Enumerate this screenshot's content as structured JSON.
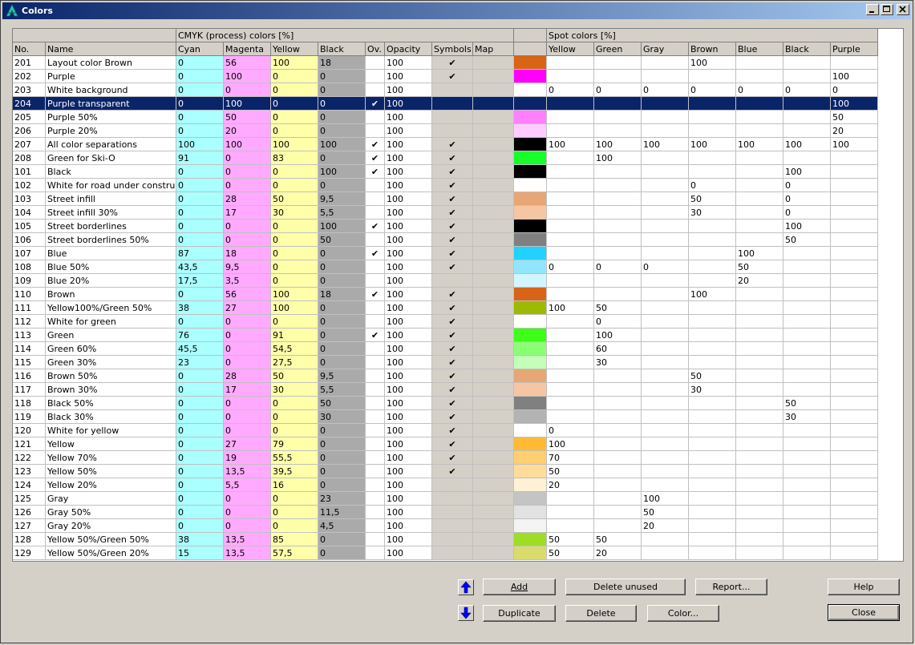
{
  "window": {
    "title": "Colors"
  },
  "header": {
    "group_cmyk": "CMYK (process) colors [%]",
    "group_spot": "Spot colors [%]",
    "columns": [
      "No.",
      "Name",
      "Cyan",
      "Magenta",
      "Yellow",
      "Black",
      "Ov.",
      "Opacity",
      "Symbols",
      "Map",
      "",
      "Yellow",
      "Green",
      "Gray",
      "Brown",
      "Blue",
      "Black",
      "Purple"
    ]
  },
  "selected_row": 3,
  "check_glyph": "✔",
  "rows": [
    {
      "no": "201",
      "name": "Layout color Brown",
      "c": "0",
      "m": "56",
      "y": "100",
      "k": "18",
      "ov": false,
      "op": "100",
      "sym": true,
      "color": "#d86418",
      "spot": [
        "",
        "",
        "",
        "100",
        "",
        "",
        ""
      ]
    },
    {
      "no": "202",
      "name": "Purple",
      "c": "0",
      "m": "100",
      "y": "0",
      "k": "0",
      "ov": false,
      "op": "100",
      "sym": true,
      "color": "#ff00ff",
      "spot": [
        "",
        "",
        "",
        "",
        "",
        "",
        "100"
      ]
    },
    {
      "no": "203",
      "name": "White background",
      "c": "0",
      "m": "0",
      "y": "0",
      "k": "0",
      "ov": false,
      "op": "100",
      "sym": false,
      "color": "#ffffff",
      "spot": [
        "0",
        "0",
        "0",
        "0",
        "0",
        "0",
        "0"
      ]
    },
    {
      "no": "204",
      "name": "Purple transparent",
      "c": "0",
      "m": "100",
      "y": "0",
      "k": "0",
      "ov": true,
      "op": "100",
      "sym": false,
      "color": "#ff00ff",
      "spot": [
        "",
        "",
        "",
        "",
        "",
        "",
        "100"
      ]
    },
    {
      "no": "205",
      "name": "Purple 50%",
      "c": "0",
      "m": "50",
      "y": "0",
      "k": "0",
      "ov": false,
      "op": "100",
      "sym": false,
      "color": "#ff80ff",
      "spot": [
        "",
        "",
        "",
        "",
        "",
        "",
        "50"
      ]
    },
    {
      "no": "206",
      "name": "Purple 20%",
      "c": "0",
      "m": "20",
      "y": "0",
      "k": "0",
      "ov": false,
      "op": "100",
      "sym": false,
      "color": "#ffccff",
      "spot": [
        "",
        "",
        "",
        "",
        "",
        "",
        "20"
      ]
    },
    {
      "no": "207",
      "name": "All color separations",
      "c": "100",
      "m": "100",
      "y": "100",
      "k": "100",
      "ov": true,
      "op": "100",
      "sym": true,
      "color": "#000000",
      "spot": [
        "100",
        "100",
        "100",
        "100",
        "100",
        "100",
        "100"
      ]
    },
    {
      "no": "208",
      "name": "Green for Ski-O",
      "c": "91",
      "m": "0",
      "y": "83",
      "k": "0",
      "ov": true,
      "op": "100",
      "sym": true,
      "color": "#17ff2b",
      "spot": [
        "",
        "100",
        "",
        "",
        "",
        "",
        ""
      ]
    },
    {
      "no": "101",
      "name": "Black",
      "c": "0",
      "m": "0",
      "y": "0",
      "k": "100",
      "ov": true,
      "op": "100",
      "sym": true,
      "color": "#000000",
      "spot": [
        "",
        "",
        "",
        "",
        "",
        "100",
        ""
      ]
    },
    {
      "no": "102",
      "name": "White for road under construct.",
      "c": "0",
      "m": "0",
      "y": "0",
      "k": "0",
      "ov": false,
      "op": "100",
      "sym": true,
      "color": "#ffffff",
      "spot": [
        "",
        "",
        "",
        "0",
        "",
        "0",
        ""
      ]
    },
    {
      "no": "103",
      "name": "Street infill",
      "c": "0",
      "m": "28",
      "y": "50",
      "k": "9,5",
      "ov": false,
      "op": "100",
      "sym": true,
      "color": "#e7a774",
      "spot": [
        "",
        "",
        "",
        "50",
        "",
        "0",
        ""
      ]
    },
    {
      "no": "104",
      "name": "Street infill 30%",
      "c": "0",
      "m": "17",
      "y": "30",
      "k": "5,5",
      "ov": false,
      "op": "100",
      "sym": true,
      "color": "#f6c6a2",
      "spot": [
        "",
        "",
        "",
        "30",
        "",
        "0",
        ""
      ]
    },
    {
      "no": "105",
      "name": "Street borderlines",
      "c": "0",
      "m": "0",
      "y": "0",
      "k": "100",
      "ov": true,
      "op": "100",
      "sym": true,
      "color": "#000000",
      "spot": [
        "",
        "",
        "",
        "",
        "",
        "100",
        ""
      ]
    },
    {
      "no": "106",
      "name": "Street borderlines 50%",
      "c": "0",
      "m": "0",
      "y": "0",
      "k": "50",
      "ov": false,
      "op": "100",
      "sym": true,
      "color": "#808080",
      "spot": [
        "",
        "",
        "",
        "",
        "",
        "50",
        ""
      ]
    },
    {
      "no": "107",
      "name": "Blue",
      "c": "87",
      "m": "18",
      "y": "0",
      "k": "0",
      "ov": true,
      "op": "100",
      "sym": true,
      "color": "#21d1ff",
      "spot": [
        "",
        "",
        "",
        "",
        "100",
        "",
        ""
      ]
    },
    {
      "no": "108",
      "name": "Blue 50%",
      "c": "43,5",
      "m": "9,5",
      "y": "0",
      "k": "0",
      "ov": false,
      "op": "100",
      "sym": true,
      "color": "#90e6ff",
      "spot": [
        "0",
        "0",
        "0",
        "",
        "50",
        "",
        ""
      ]
    },
    {
      "no": "109",
      "name": "Blue 20%",
      "c": "17,5",
      "m": "3,5",
      "y": "0",
      "k": "0",
      "ov": false,
      "op": "100",
      "sym": false,
      "color": "#d2f6ff",
      "spot": [
        "",
        "",
        "",
        "",
        "20",
        "",
        ""
      ]
    },
    {
      "no": "110",
      "name": "Brown",
      "c": "0",
      "m": "56",
      "y": "100",
      "k": "18",
      "ov": true,
      "op": "100",
      "sym": true,
      "color": "#d86418",
      "spot": [
        "",
        "",
        "",
        "100",
        "",
        "",
        ""
      ]
    },
    {
      "no": "111",
      "name": "Yellow100%/Green 50%",
      "c": "38",
      "m": "27",
      "y": "100",
      "k": "0",
      "ov": false,
      "op": "100",
      "sym": true,
      "color": "#9eba00",
      "spot": [
        "100",
        "50",
        "",
        "",
        "",
        "",
        ""
      ]
    },
    {
      "no": "112",
      "name": "White for green",
      "c": "0",
      "m": "0",
      "y": "0",
      "k": "0",
      "ov": false,
      "op": "100",
      "sym": true,
      "color": "#ffffff",
      "spot": [
        "",
        "0",
        "",
        "",
        "",
        "",
        ""
      ]
    },
    {
      "no": "113",
      "name": "Green",
      "c": "76",
      "m": "0",
      "y": "91",
      "k": "0",
      "ov": true,
      "op": "100",
      "sym": true,
      "color": "#3dff17",
      "spot": [
        "",
        "100",
        "",
        "",
        "",
        "",
        ""
      ]
    },
    {
      "no": "114",
      "name": "Green 60%",
      "c": "45,5",
      "m": "0",
      "y": "54,5",
      "k": "0",
      "ov": false,
      "op": "100",
      "sym": true,
      "color": "#8bff74",
      "spot": [
        "",
        "60",
        "",
        "",
        "",
        "",
        ""
      ]
    },
    {
      "no": "115",
      "name": "Green 30%",
      "c": "23",
      "m": "0",
      "y": "27,5",
      "k": "0",
      "ov": false,
      "op": "100",
      "sym": true,
      "color": "#c4ffb9",
      "spot": [
        "",
        "30",
        "",
        "",
        "",
        "",
        ""
      ]
    },
    {
      "no": "116",
      "name": "Brown 50%",
      "c": "0",
      "m": "28",
      "y": "50",
      "k": "9,5",
      "ov": false,
      "op": "100",
      "sym": true,
      "color": "#e7a774",
      "spot": [
        "",
        "",
        "",
        "50",
        "",
        "",
        ""
      ]
    },
    {
      "no": "117",
      "name": "Brown 30%",
      "c": "0",
      "m": "17",
      "y": "30",
      "k": "5,5",
      "ov": false,
      "op": "100",
      "sym": true,
      "color": "#f6c6a2",
      "spot": [
        "",
        "",
        "",
        "30",
        "",
        "",
        ""
      ]
    },
    {
      "no": "118",
      "name": "Black 50%",
      "c": "0",
      "m": "0",
      "y": "0",
      "k": "50",
      "ov": false,
      "op": "100",
      "sym": true,
      "color": "#808080",
      "spot": [
        "",
        "",
        "",
        "",
        "",
        "50",
        ""
      ]
    },
    {
      "no": "119",
      "name": "Black 30%",
      "c": "0",
      "m": "0",
      "y": "0",
      "k": "30",
      "ov": false,
      "op": "100",
      "sym": true,
      "color": "#b3b3b3",
      "spot": [
        "",
        "",
        "",
        "",
        "",
        "30",
        ""
      ]
    },
    {
      "no": "120",
      "name": "White for yellow",
      "c": "0",
      "m": "0",
      "y": "0",
      "k": "0",
      "ov": false,
      "op": "100",
      "sym": true,
      "color": "#ffffff",
      "spot": [
        "0",
        "",
        "",
        "",
        "",
        "",
        ""
      ]
    },
    {
      "no": "121",
      "name": "Yellow",
      "c": "0",
      "m": "27",
      "y": "79",
      "k": "0",
      "ov": false,
      "op": "100",
      "sym": true,
      "color": "#ffba35",
      "spot": [
        "100",
        "",
        "",
        "",
        "",
        "",
        ""
      ]
    },
    {
      "no": "122",
      "name": "Yellow 70%",
      "c": "0",
      "m": "19",
      "y": "55,5",
      "k": "0",
      "ov": false,
      "op": "100",
      "sym": true,
      "color": "#ffcf71",
      "spot": [
        "70",
        "",
        "",
        "",
        "",
        "",
        ""
      ]
    },
    {
      "no": "123",
      "name": "Yellow 50%",
      "c": "0",
      "m": "13,5",
      "y": "39,5",
      "k": "0",
      "ov": false,
      "op": "100",
      "sym": true,
      "color": "#ffdc9a",
      "spot": [
        "50",
        "",
        "",
        "",
        "",
        "",
        ""
      ]
    },
    {
      "no": "124",
      "name": "Yellow 20%",
      "c": "0",
      "m": "5,5",
      "y": "16",
      "k": "0",
      "ov": false,
      "op": "100",
      "sym": false,
      "color": "#fff1d6",
      "spot": [
        "20",
        "",
        "",
        "",
        "",
        "",
        ""
      ]
    },
    {
      "no": "125",
      "name": "Gray",
      "c": "0",
      "m": "0",
      "y": "0",
      "k": "23",
      "ov": false,
      "op": "100",
      "sym": false,
      "color": "#c4c4c4",
      "spot": [
        "",
        "",
        "100",
        "",
        "",
        "",
        ""
      ]
    },
    {
      "no": "126",
      "name": "Gray 50%",
      "c": "0",
      "m": "0",
      "y": "0",
      "k": "11,5",
      "ov": false,
      "op": "100",
      "sym": false,
      "color": "#e2e2e2",
      "spot": [
        "",
        "",
        "50",
        "",
        "",
        "",
        ""
      ]
    },
    {
      "no": "127",
      "name": "Gray 20%",
      "c": "0",
      "m": "0",
      "y": "0",
      "k": "4,5",
      "ov": false,
      "op": "100",
      "sym": false,
      "color": "#f3f3f3",
      "spot": [
        "",
        "",
        "20",
        "",
        "",
        "",
        ""
      ]
    },
    {
      "no": "128",
      "name": "Yellow 50%/Green 50%",
      "c": "38",
      "m": "13,5",
      "y": "85",
      "k": "0",
      "ov": false,
      "op": "100",
      "sym": false,
      "color": "#9edc26",
      "spot": [
        "50",
        "50",
        "",
        "",
        "",
        "",
        ""
      ]
    },
    {
      "no": "129",
      "name": "Yellow 50%/Green 20%",
      "c": "15",
      "m": "13,5",
      "y": "57,5",
      "k": "0",
      "ov": false,
      "op": "100",
      "sym": false,
      "color": "#d9dc6d",
      "spot": [
        "50",
        "20",
        "",
        "",
        "",
        "",
        ""
      ]
    }
  ],
  "buttons": {
    "add": "Add",
    "delete_unused": "Delete unused",
    "report": "Report...",
    "help": "Help",
    "duplicate": "Duplicate",
    "delete": "Delete",
    "color": "Color...",
    "close": "Close"
  },
  "colors": {
    "title_start": "#0a246a",
    "title_end": "#a6caf0",
    "selection": "#0a246a",
    "cyan_col": "#aaffff",
    "magenta_col": "#ffaaff",
    "yellow_col": "#ffffaa",
    "black_col": "#aaaaaa"
  }
}
